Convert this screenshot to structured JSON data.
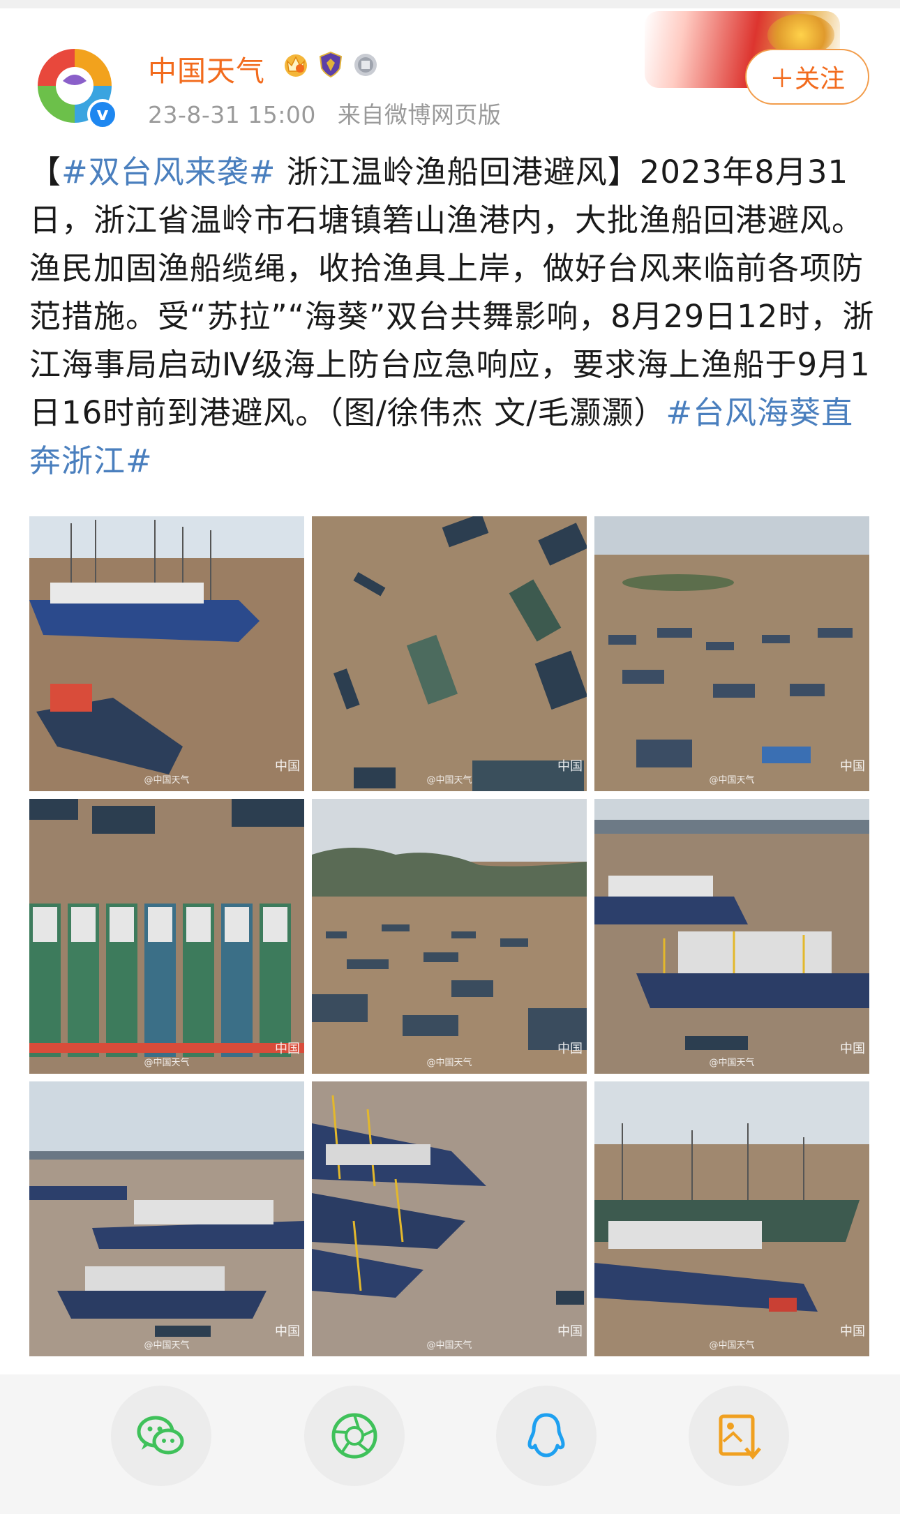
{
  "post": {
    "username": "中国天气",
    "time": "23-8-31 15:00",
    "source": "来自微博网页版",
    "follow_label": "＋关注",
    "verified_mark": "v",
    "badge_icons": [
      "crown-badge-icon",
      "shield-badge-icon",
      "answer-badge-icon"
    ],
    "text": {
      "open_bracket": "【",
      "hashtag1": "#双台风来袭#",
      "part1": " 浙江温岭渔船回港避风】2023年8月31日，浙江省温岭市石塘镇箬山渔港内，大批渔船回港避风。渔民加固渔船缆绳，收拾渔具上岸，做好台风来临前各项防范措施。受“苏拉”“海葵”双台共舞影响，8月29日12时，浙江海事局启动Ⅳ级海上防台应急响应，要求海上渔船于9月1日16时前到港避风。（图/徐伟杰 文/毛灏灏）",
      "hashtag2": "#台风海葵直奔浙江#"
    }
  },
  "photos": {
    "watermark_left": "@中国天气",
    "watermark_right": "中国",
    "items": [
      {
        "label": "photo-1"
      },
      {
        "label": "photo-2"
      },
      {
        "label": "photo-3"
      },
      {
        "label": "photo-4"
      },
      {
        "label": "photo-5"
      },
      {
        "label": "photo-6"
      },
      {
        "label": "photo-7"
      },
      {
        "label": "photo-8"
      },
      {
        "label": "photo-9"
      }
    ]
  },
  "share": {
    "buttons": [
      {
        "icon": "wechat-icon",
        "color": "#3fc15a"
      },
      {
        "icon": "moments-icon",
        "color": "#3fc15a"
      },
      {
        "icon": "qq-icon",
        "color": "#1ea0f0"
      },
      {
        "icon": "save-image-icon",
        "color": "#f0a020"
      }
    ]
  },
  "colors": {
    "username": "#f26b1d",
    "hashtag": "#4a7fbe",
    "meta": "#9a9a9a"
  }
}
